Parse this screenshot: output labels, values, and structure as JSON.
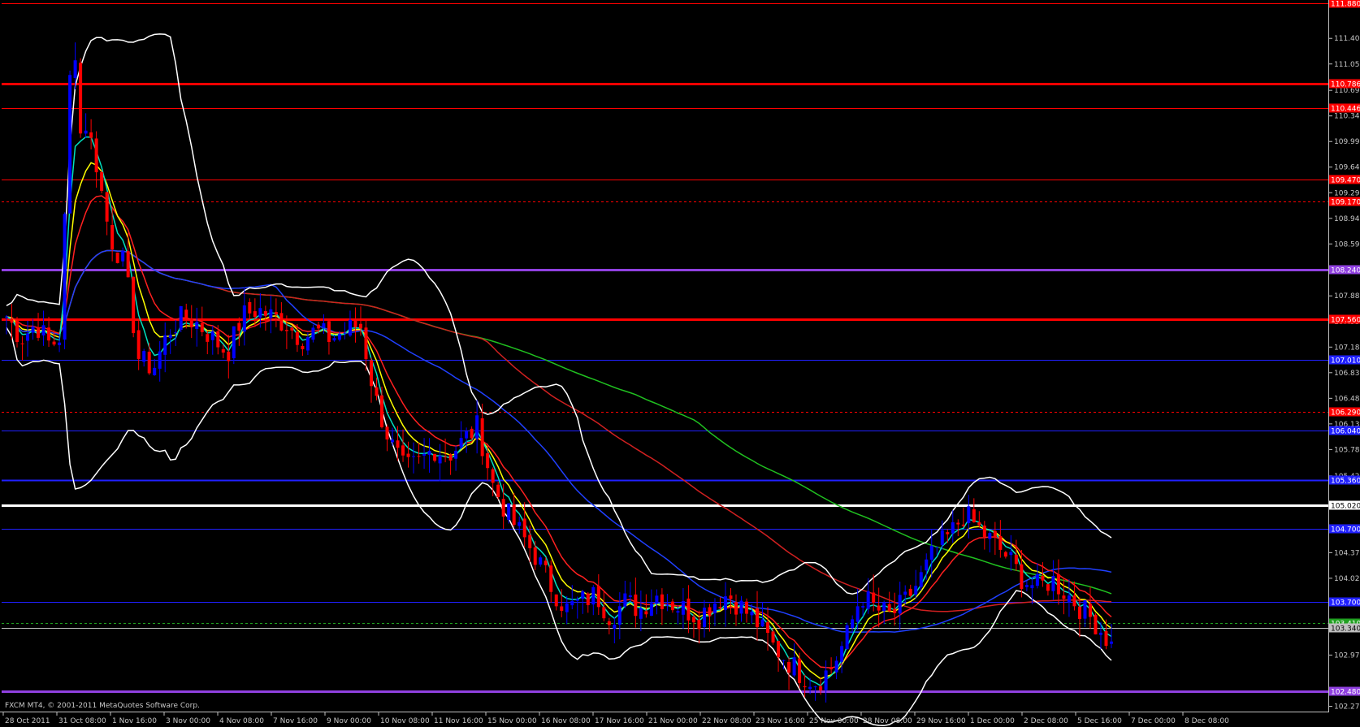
{
  "window": {
    "copyright": "FXCM MT4, © 2001-2011 MetaQuotes Software Corp."
  },
  "colors": {
    "background": "#000000",
    "axis": "#c0c0c0",
    "bull": "#0000ff",
    "bear": "#ff0000",
    "bb": "#ffffff",
    "ema_fast": "#00e0c0",
    "ema_mid": "#ffff00",
    "ema_slow": "#ff2020",
    "sma_blue": "#2040ff",
    "sma_red": "#d02020",
    "sma_green": "#20c020"
  },
  "chart_data": {
    "type": "candlestick",
    "title": "",
    "ylim": [
      102.22,
      111.88
    ],
    "price_ticks": [
      "111.400",
      "111.050",
      "110.690",
      "110.340",
      "109.990",
      "109.640",
      "109.290",
      "108.940",
      "108.590",
      "107.880",
      "107.530",
      "107.180",
      "106.830",
      "106.480",
      "106.130",
      "105.780",
      "105.420",
      "104.370",
      "104.020",
      "102.970",
      "102.270"
    ],
    "time_ticks": [
      "28 Oct 2011",
      "31 Oct 08:00",
      "1 Nov 16:00",
      "3 Nov 00:00",
      "4 Nov 08:00",
      "7 Nov 16:00",
      "9 Nov 00:00",
      "10 Nov 08:00",
      "11 Nov 16:00",
      "15 Nov 00:00",
      "16 Nov 08:00",
      "17 Nov 16:00",
      "21 Nov 00:00",
      "22 Nov 08:00",
      "23 Nov 16:00",
      "25 Nov 00:00",
      "28 Nov 08:00",
      "29 Nov 16:00",
      "1 Dec 00:00",
      "2 Dec 08:00",
      "5 Dec 16:00",
      "7 Dec 00:00",
      "8 Dec 08:00"
    ],
    "levels": [
      {
        "price": 110.786,
        "label": "110.786",
        "color": "#ff0000",
        "style": "thick"
      },
      {
        "price": 110.446,
        "label": "110.446",
        "color": "#ff0000",
        "style": "thin"
      },
      {
        "price": 109.47,
        "label": "109.470",
        "color": "#ff0000",
        "style": "thin"
      },
      {
        "price": 109.17,
        "label": "109.170",
        "color": "#ff0000",
        "style": "dashed"
      },
      {
        "price": 108.24,
        "label": "108.240",
        "color": "#9040e0",
        "style": "thick"
      },
      {
        "price": 107.56,
        "label": "107.560",
        "color": "#ff0000",
        "style": "thick"
      },
      {
        "price": 107.01,
        "label": "107.010",
        "color": "#2020ff",
        "style": "thin"
      },
      {
        "price": 106.29,
        "label": "106.290",
        "color": "#ff0000",
        "style": "dashed"
      },
      {
        "price": 106.04,
        "label": "106.040",
        "color": "#2020ff",
        "style": "thin"
      },
      {
        "price": 105.36,
        "label": "105.360",
        "color": "#2020ff",
        "style": "medium"
      },
      {
        "price": 105.02,
        "label": "105.020",
        "color": "#ffffff",
        "style": "thick"
      },
      {
        "price": 104.7,
        "label": "104.700",
        "color": "#2020ff",
        "style": "thin"
      },
      {
        "price": 103.7,
        "label": "103.700",
        "color": "#2020ff",
        "style": "thin"
      },
      {
        "price": 103.41,
        "label": "103.410",
        "color": "#20a020",
        "style": "dashed"
      },
      {
        "price": 103.34,
        "label": "103.340",
        "color": "#c0c0c0",
        "style": "thin"
      },
      {
        "price": 102.48,
        "label": "102.480",
        "color": "#9040e0",
        "style": "thick"
      },
      {
        "price": 111.88,
        "label": "111.880",
        "color": "#ff0000",
        "style": "thin"
      }
    ],
    "close_path": [
      107.6,
      107.3,
      107.5,
      107.2,
      107.4,
      110.5,
      109.8,
      108.7,
      108.3,
      107.0,
      106.9,
      107.4,
      107.6,
      107.5,
      107.3,
      107.1,
      107.6,
      107.7,
      107.6,
      107.5,
      107.3,
      107.4,
      107.3,
      107.4,
      107.5,
      106.5,
      105.9,
      105.5,
      105.6,
      105.8,
      105.7,
      105.9,
      106.1,
      105.3,
      104.9,
      104.6,
      104.3,
      103.9,
      103.6,
      103.7,
      103.8,
      103.5,
      103.7,
      103.6,
      103.8,
      103.7,
      103.6,
      103.5,
      103.7,
      103.8,
      103.6,
      103.4,
      103.1,
      102.9,
      102.7,
      102.6,
      102.8,
      103.2,
      103.8,
      103.6,
      103.5,
      103.7,
      104.0,
      104.4,
      104.6,
      104.9,
      104.7,
      104.5,
      104.3,
      104.0,
      103.9,
      104.0,
      103.8,
      103.6,
      103.4,
      103.1
    ]
  }
}
